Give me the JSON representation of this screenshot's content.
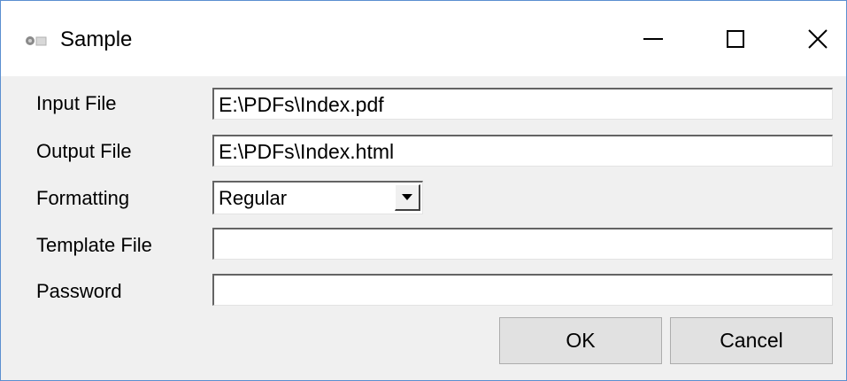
{
  "window": {
    "title": "Sample"
  },
  "form": {
    "input_file": {
      "label": "Input File",
      "value": "E:\\PDFs\\Index.pdf"
    },
    "output_file": {
      "label": "Output File",
      "value": "E:\\PDFs\\Index.html"
    },
    "formatting": {
      "label": "Formatting",
      "value": "Regular"
    },
    "template_file": {
      "label": "Template File",
      "value": ""
    },
    "password": {
      "label": "Password",
      "value": ""
    }
  },
  "buttons": {
    "ok": "OK",
    "cancel": "Cancel"
  },
  "icons": {
    "app": "app-icon",
    "minimize": "minimize-icon",
    "maximize": "maximize-icon",
    "close": "close-icon",
    "dropdown": "dropdown-arrow-icon"
  }
}
